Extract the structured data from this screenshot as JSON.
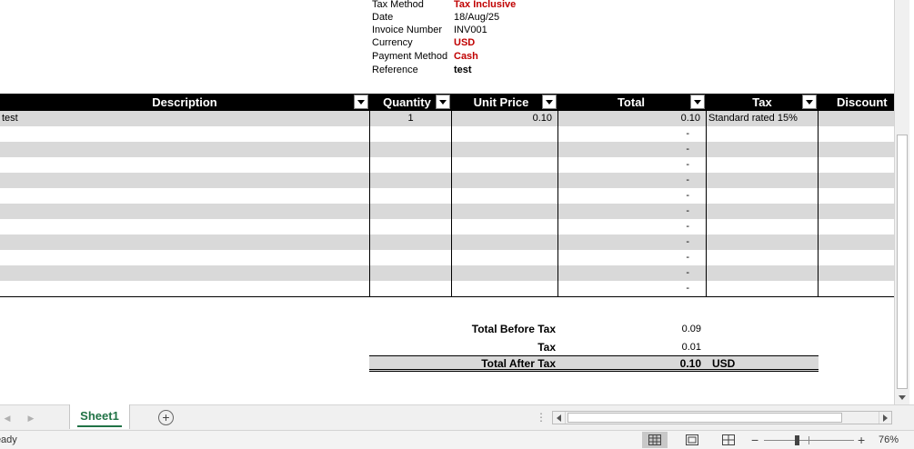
{
  "invoice_info": [
    {
      "label": "Tax Method",
      "value": "Tax Inclusive",
      "style": "red"
    },
    {
      "label": "Date",
      "value": "18/Aug/25",
      "style": "normal"
    },
    {
      "label": "Invoice Number",
      "value": "INV001",
      "style": "normal"
    },
    {
      "label": "Currency",
      "value": "USD",
      "style": "red"
    },
    {
      "label": "Payment Method",
      "value": "Cash",
      "style": "red"
    },
    {
      "label": "Reference",
      "value": "test",
      "style": "bold"
    }
  ],
  "table": {
    "headers": {
      "description": "Description",
      "quantity": "Quantity",
      "unit_price": "Unit Price",
      "total": "Total",
      "tax": "Tax",
      "discount": "Discount"
    },
    "rows": [
      {
        "description": "test",
        "quantity": "1",
        "unit_price": "0.10",
        "total": "0.10",
        "tax": "Standard rated 15%"
      },
      {
        "description": "",
        "quantity": "",
        "unit_price": "",
        "total": "-",
        "tax": ""
      },
      {
        "description": "",
        "quantity": "",
        "unit_price": "",
        "total": "-",
        "tax": ""
      },
      {
        "description": "",
        "quantity": "",
        "unit_price": "",
        "total": "-",
        "tax": ""
      },
      {
        "description": "",
        "quantity": "",
        "unit_price": "",
        "total": "-",
        "tax": ""
      },
      {
        "description": "",
        "quantity": "",
        "unit_price": "",
        "total": "-",
        "tax": ""
      },
      {
        "description": "",
        "quantity": "",
        "unit_price": "",
        "total": "-",
        "tax": ""
      },
      {
        "description": "",
        "quantity": "",
        "unit_price": "",
        "total": "-",
        "tax": ""
      },
      {
        "description": "",
        "quantity": "",
        "unit_price": "",
        "total": "-",
        "tax": ""
      },
      {
        "description": "",
        "quantity": "",
        "unit_price": "",
        "total": "-",
        "tax": ""
      },
      {
        "description": "",
        "quantity": "",
        "unit_price": "",
        "total": "-",
        "tax": ""
      },
      {
        "description": "",
        "quantity": "",
        "unit_price": "",
        "total": "-",
        "tax": ""
      }
    ]
  },
  "totals": {
    "before_tax_label": "Total Before Tax",
    "before_tax_value": "0.09",
    "tax_label": "Tax",
    "tax_value": "0.01",
    "after_tax_label": "Total After Tax",
    "after_tax_value": "0.10",
    "after_tax_currency": "USD"
  },
  "sheet_tabs": {
    "active": "Sheet1",
    "add_icon": "plus-circle-icon"
  },
  "status": {
    "text": "Ready",
    "zoom": "76%",
    "view_icons": [
      "normal-view-icon",
      "page-layout-icon",
      "page-break-preview-icon"
    ]
  },
  "colors": {
    "accent_red": "#c00000",
    "header_bg": "#000000",
    "band_grey": "#d9d9d9",
    "excel_green": "#217346"
  }
}
